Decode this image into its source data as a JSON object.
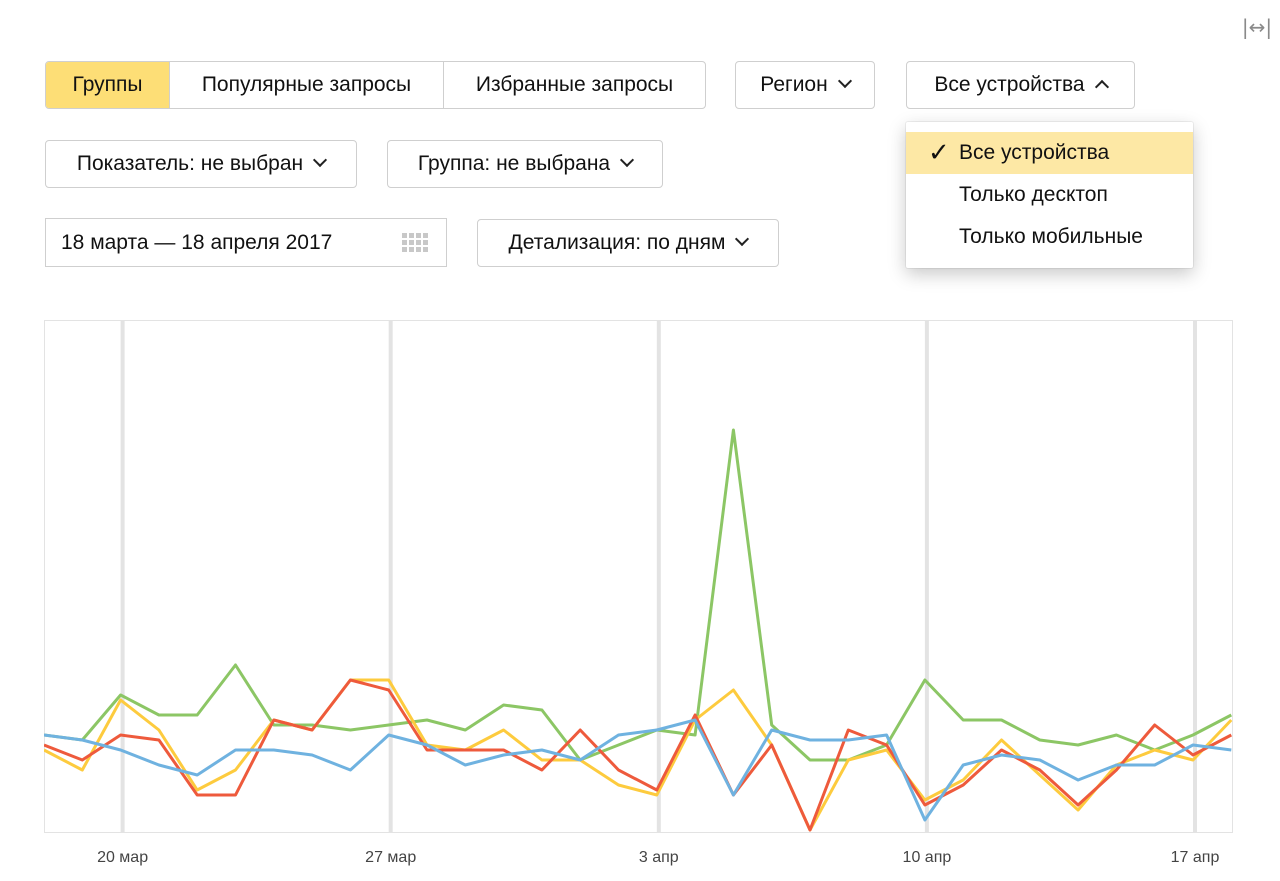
{
  "toolbar": {
    "expand_icon_glyph": "|↔|",
    "tabs": [
      {
        "label": "Группы",
        "active": true
      },
      {
        "label": "Популярные запросы",
        "active": false
      },
      {
        "label": "Избранные запросы",
        "active": false
      }
    ],
    "region_label": "Регион",
    "devices_label": "Все устройства",
    "indicator_label": "Показатель: не выбран",
    "group_label": "Группа: не выбрана",
    "date_range": "18 марта — 18 апреля 2017",
    "detail_label": "Детализация: по дням"
  },
  "devices_menu": {
    "check_glyph": "✓",
    "items": [
      {
        "label": "Все устройства",
        "selected": true
      },
      {
        "label": "Только десктоп",
        "selected": false
      },
      {
        "label": "Только мобильные",
        "selected": false
      }
    ]
  },
  "colors": {
    "accent": "#fdde76",
    "grid": "#e3e3e3",
    "border": "#cfcfcf"
  },
  "chart_data": {
    "type": "line",
    "x": [
      "18 мар",
      "19 мар",
      "20 мар",
      "21 мар",
      "22 мар",
      "23 мар",
      "24 мар",
      "25 мар",
      "26 мар",
      "27 мар",
      "28 мар",
      "29 мар",
      "30 мар",
      "31 мар",
      "1 апр",
      "2 апр",
      "3 апр",
      "4 апр",
      "5 апр",
      "6 апр",
      "7 апр",
      "8 апр",
      "9 апр",
      "10 апр",
      "11 апр",
      "12 апр",
      "13 апр",
      "14 апр",
      "15 апр",
      "16 апр",
      "17 апр",
      "18 апр"
    ],
    "x_ticks": [
      {
        "index": 2,
        "label": "20 мар"
      },
      {
        "index": 9,
        "label": "27 мар"
      },
      {
        "index": 16,
        "label": "3 апр"
      },
      {
        "index": 23,
        "label": "10 апр"
      },
      {
        "index": 30,
        "label": "17 апр"
      }
    ],
    "ylim": [
      0,
      100
    ],
    "grid": "vertical",
    "series": [
      {
        "color": "#8cc665",
        "values": [
          19,
          18,
          27,
          23,
          23,
          33,
          21,
          21,
          20,
          21,
          22,
          20,
          25,
          24,
          14,
          17,
          20,
          19,
          80,
          21,
          14,
          14,
          17,
          30,
          22,
          22,
          18,
          17,
          19,
          16,
          19,
          23
        ]
      },
      {
        "color": "#fdcb3e",
        "values": [
          16,
          12,
          26,
          20,
          8,
          12,
          22,
          20,
          30,
          30,
          17,
          16,
          20,
          14,
          14,
          9,
          7,
          22,
          28,
          17,
          0,
          14,
          16,
          6,
          10,
          18,
          11,
          4,
          13,
          16,
          14,
          22
        ]
      },
      {
        "color": "#ee5a3c",
        "values": [
          17,
          14,
          19,
          18,
          7,
          7,
          22,
          20,
          30,
          28,
          16,
          16,
          16,
          12,
          20,
          12,
          8,
          23,
          7,
          17,
          0,
          20,
          17,
          5,
          9,
          16,
          12,
          5,
          12,
          21,
          15,
          19
        ]
      },
      {
        "color": "#6fb2e0",
        "values": [
          19,
          18,
          16,
          13,
          11,
          16,
          16,
          15,
          12,
          19,
          17,
          13,
          15,
          16,
          14,
          19,
          20,
          22,
          7,
          20,
          18,
          18,
          19,
          2,
          13,
          15,
          14,
          10,
          13,
          13,
          17,
          16
        ]
      }
    ]
  }
}
